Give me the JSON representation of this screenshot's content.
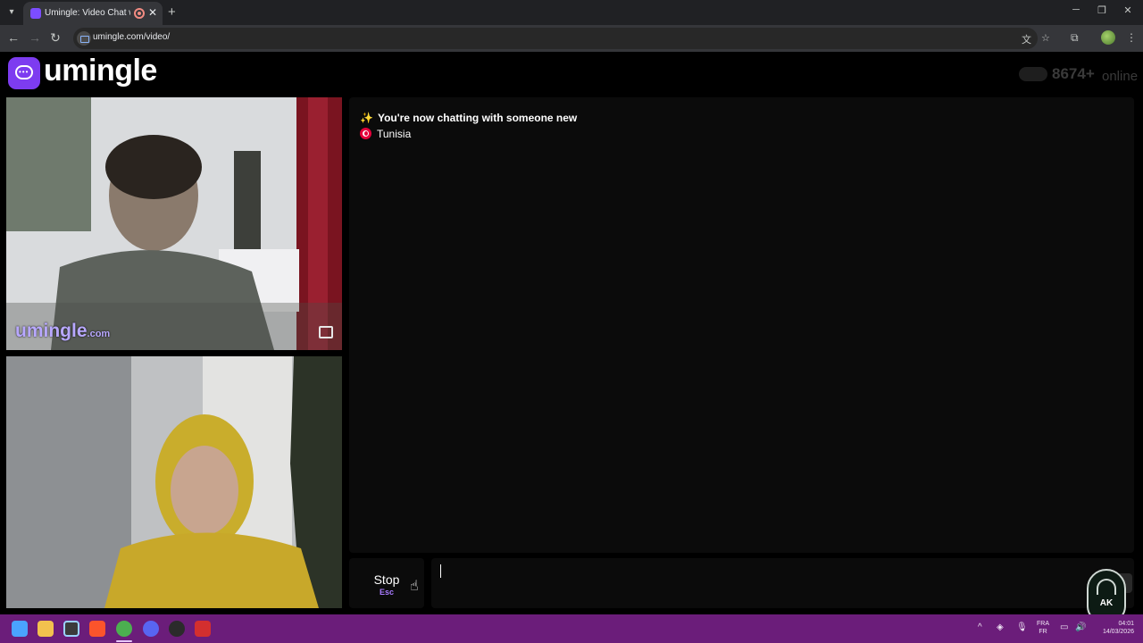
{
  "browser": {
    "tab_title": "Umingle: Video Chat with S",
    "tab_close": "✕",
    "new_tab": "+",
    "url": "umingle.com/video/",
    "window_controls": [
      "─",
      "❐",
      "✕"
    ]
  },
  "site": {
    "logo_text": "umingle",
    "online_count": "8674+",
    "online_label": "online",
    "accent_color": "#7d3cf0"
  },
  "videos": {
    "remote_watermark_main": "umingle",
    "remote_watermark_sub": ".com"
  },
  "chat": {
    "system_message": "You're now chatting with someone new",
    "country": "Tunisia",
    "sparkle_icon": "✨"
  },
  "controls": {
    "stop_label": "Stop",
    "stop_key": "Esc"
  },
  "badge": {
    "text": "AK"
  },
  "taskbar": {
    "language_top": "FRA",
    "language_bottom": "FR",
    "time": "04:01",
    "date": "14/03/2026"
  }
}
